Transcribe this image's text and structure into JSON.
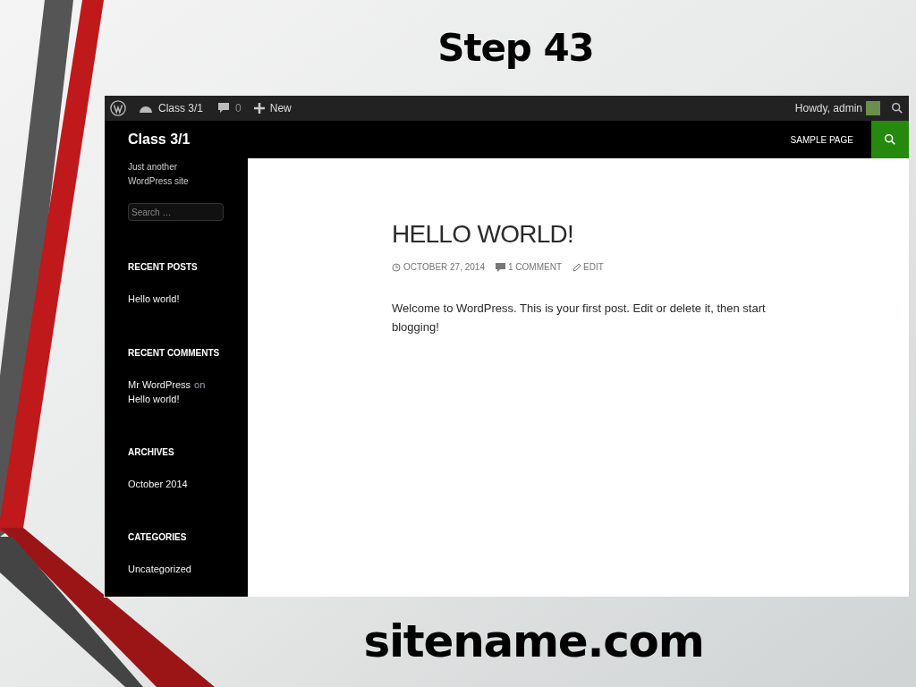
{
  "slide": {
    "title": "Step 43",
    "footer": "sitename.com"
  },
  "admin_bar": {
    "site": "Class 3/1",
    "comments": "0",
    "new": "New",
    "greeting": "Howdy, admin"
  },
  "header": {
    "site_title": "Class 3/1",
    "nav": [
      {
        "label": "SAMPLE PAGE"
      }
    ]
  },
  "sidebar": {
    "tagline": "Just another WordPress site",
    "search_placeholder": "Search …",
    "widgets": [
      {
        "title": "RECENT POSTS",
        "items": [
          {
            "kind": "link",
            "text": "Hello world!"
          }
        ]
      },
      {
        "title": "RECENT COMMENTS",
        "items": [
          {
            "kind": "comment",
            "author": "Mr WordPress",
            "connector": "on",
            "post": "Hello world!"
          }
        ]
      },
      {
        "title": "ARCHIVES",
        "items": [
          {
            "kind": "link",
            "text": "October 2014"
          }
        ]
      },
      {
        "title": "CATEGORIES",
        "items": [
          {
            "kind": "link",
            "text": "Uncategorized"
          }
        ]
      }
    ]
  },
  "post": {
    "title": "HELLO WORLD!",
    "date": "OCTOBER 27, 2014",
    "comments": "1 COMMENT",
    "edit": "EDIT",
    "body": "Welcome to WordPress. This is your first post. Edit or delete it, then start blogging!"
  }
}
